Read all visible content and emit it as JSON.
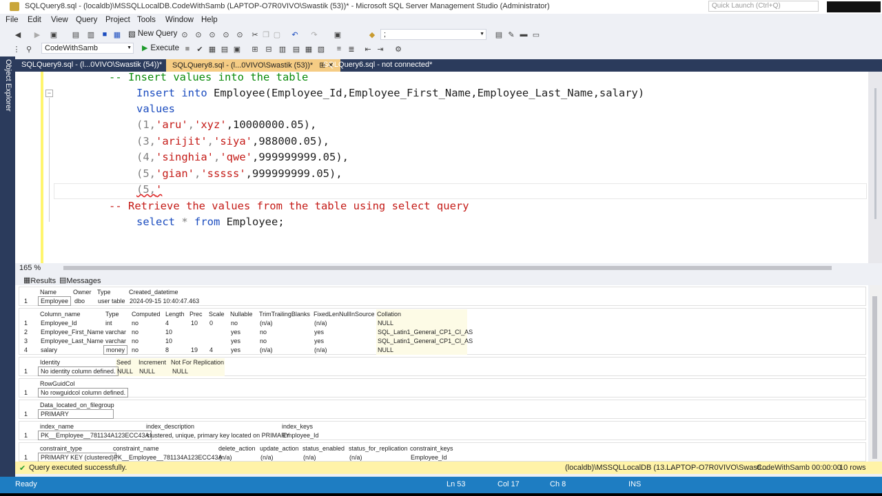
{
  "title_bar": {
    "title": "SQLQuery8.sql - (localdb)\\MSSQLLocalDB.CodeWithSamb (LAPTOP-O7R0VIVO\\Swastik (53))* - Microsoft SQL Server Management Studio (Administrator)",
    "quick_launch": "Quick Launch (Ctrl+Q)"
  },
  "menu": [
    "File",
    "Edit",
    "View",
    "Query",
    "Project",
    "Tools",
    "Window",
    "Help"
  ],
  "toolbar": {
    "new_query": "New Query",
    "search_combo_value": ";",
    "database": "CodeWithSamb",
    "execute": "Execute"
  },
  "object_explorer_label": "Object Explorer",
  "doc_tabs": [
    {
      "label": "SQLQuery9.sql - (l...0VIVO\\Swastik (54))*"
    },
    {
      "label": "SQLQuery8.sql - (l...0VIVO\\Swastik (53))*",
      "pin": "⊞ ✕"
    },
    {
      "label": "SQLQuery6.sql - not connected*"
    }
  ],
  "code_lines": {
    "l1": "-- Insert values into the table",
    "l2_kw": "Insert into",
    "l2_rest": " Employee(Employee_Id,Employee_First_Name,Employee_Last_Name,salary)",
    "l3": "values",
    "l4_a": "(1,",
    "l4_s1": "'aru'",
    "l4_b": ",",
    "l4_s2": "'xyz'",
    "l4_c": ",10000000.05),",
    "l5_a": "(3,",
    "l5_s1": "'arijit'",
    "l5_b": ",",
    "l5_s2": "'siya'",
    "l5_c": ",988000.05),",
    "l6_a": "(4,",
    "l6_s1": "'singhia'",
    "l6_b": ",",
    "l6_s2": "'qwe'",
    "l6_c": ",999999999.05),",
    "l7_a": "(5,",
    "l7_s1": "'gian'",
    "l7_b": ",",
    "l7_s2": "'sssss'",
    "l7_c": ",999999999.05),",
    "l8_a": "(5,",
    "l8_s1": "'",
    "l9": "-- Retrieve the values from the table using select query",
    "l10_kw": "select",
    "l10_rest": " * ",
    "l10_kw2": "from",
    "l10_end": " Employee;"
  },
  "zoom": "165 %",
  "result_tabs": {
    "results": "Results",
    "messages": "Messages"
  },
  "grid1": {
    "headers": [
      "Name",
      "Owner",
      "Type",
      "Created_datetime"
    ],
    "rows": [
      [
        "1",
        "Employee",
        "dbo",
        "user table",
        "2024-09-15 10:40:47.463"
      ]
    ]
  },
  "grid2": {
    "headers": [
      "Column_name",
      "Type",
      "Computed",
      "Length",
      "Prec",
      "Scale",
      "Nullable",
      "TrimTrailingBlanks",
      "FixedLenNullInSource",
      "Collation"
    ],
    "rows": [
      [
        "1",
        "Employee_Id",
        "int",
        "no",
        "4",
        "10",
        "0",
        "no",
        "(n/a)",
        "(n/a)",
        "NULL"
      ],
      [
        "2",
        "Employee_First_Name",
        "varchar",
        "no",
        "10",
        "",
        "",
        "yes",
        "no",
        "yes",
        "SQL_Latin1_General_CP1_CI_AS"
      ],
      [
        "3",
        "Employee_Last_Name",
        "varchar",
        "no",
        "10",
        "",
        "",
        "yes",
        "no",
        "yes",
        "SQL_Latin1_General_CP1_CI_AS"
      ],
      [
        "4",
        "salary",
        "money",
        "no",
        "8",
        "19",
        "4",
        "yes",
        "(n/a)",
        "(n/a)",
        "NULL"
      ]
    ]
  },
  "grid3": {
    "headers": [
      "Identity",
      "Seed",
      "Increment",
      "Not For Replication"
    ],
    "rows": [
      [
        "1",
        "No identity column defined.",
        "NULL",
        "NULL",
        "NULL"
      ]
    ]
  },
  "grid4": {
    "headers": [
      "RowGuidCol"
    ],
    "rows": [
      [
        "1",
        "No rowguidcol column defined."
      ]
    ]
  },
  "grid5": {
    "headers": [
      "Data_located_on_filegroup"
    ],
    "rows": [
      [
        "1",
        "PRIMARY"
      ]
    ]
  },
  "grid6": {
    "headers": [
      "index_name",
      "index_description",
      "index_keys"
    ],
    "rows": [
      [
        "1",
        "PK__Employee__781134A123ECC43A",
        "clustered, unique, primary key located on PRIMARY",
        "Employee_Id"
      ]
    ]
  },
  "grid7": {
    "headers": [
      "constraint_type",
      "constraint_name",
      "delete_action",
      "update_action",
      "status_enabled",
      "status_for_replication",
      "constraint_keys"
    ],
    "rows": [
      [
        "1",
        "PRIMARY KEY (clustered)",
        "PK__Employee__781134A123ECC43A",
        "(n/a)",
        "(n/a)",
        "(n/a)",
        "(n/a)",
        "Employee_Id"
      ]
    ]
  },
  "query_status": {
    "message": "Query executed successfully.",
    "server": "(localdb)\\MSSQLLocalDB (13....",
    "user": "LAPTOP-O7R0VIVO\\Swasti...",
    "db": "CodeWithSamb",
    "time": "00:00:00",
    "rows": "10 rows"
  },
  "status_bar": {
    "ready": "Ready",
    "ln": "Ln 53",
    "col": "Col 17",
    "ch": "Ch 8",
    "ins": "INS"
  }
}
